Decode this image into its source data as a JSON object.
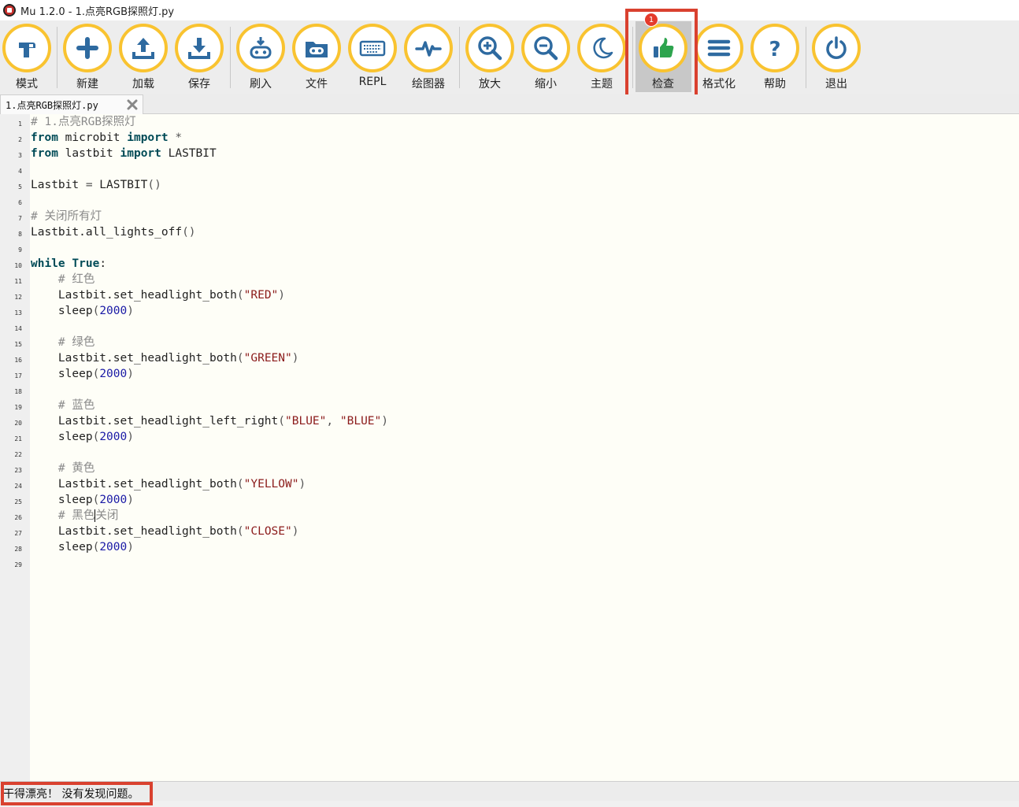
{
  "window": {
    "title": "Mu 1.2.0 - 1.点亮RGB探照灯.py"
  },
  "toolbar": {
    "buttons": [
      {
        "label": "模式",
        "icon": "mode-icon"
      },
      {
        "label": "新建",
        "icon": "plus-icon"
      },
      {
        "label": "加载",
        "icon": "upload-icon"
      },
      {
        "label": "保存",
        "icon": "download-icon"
      },
      {
        "label": "刷入",
        "icon": "flash-icon"
      },
      {
        "label": "文件",
        "icon": "files-icon"
      },
      {
        "label": "REPL",
        "icon": "keyboard-icon"
      },
      {
        "label": "绘图器",
        "icon": "pulse-icon"
      },
      {
        "label": "放大",
        "icon": "zoom-in-icon"
      },
      {
        "label": "缩小",
        "icon": "zoom-out-icon"
      },
      {
        "label": "主题",
        "icon": "moon-icon"
      },
      {
        "label": "检查",
        "icon": "thumbs-up-icon"
      },
      {
        "label": "格式化",
        "icon": "format-icon"
      },
      {
        "label": "帮助",
        "icon": "help-icon"
      },
      {
        "label": "退出",
        "icon": "power-icon"
      }
    ],
    "badge": "1",
    "colors": {
      "ring": "#f9c330",
      "icon": "#2e6aa0",
      "check": "#2da44e",
      "highlight": "#d9412f"
    }
  },
  "tab": {
    "label": "1.点亮RGB探照灯.py"
  },
  "editor": {
    "lines": [
      "# 1.点亮RGB探照灯",
      "from microbit import *",
      "from lastbit import LASTBIT",
      "",
      "Lastbit = LASTBIT()",
      "",
      "# 关闭所有灯",
      "Lastbit.all_lights_off()",
      "",
      "while True:",
      "    # 红色",
      "    Lastbit.set_headlight_both(\"RED\")",
      "    sleep(2000)",
      "",
      "    # 绿色",
      "    Lastbit.set_headlight_both(\"GREEN\")",
      "    sleep(2000)",
      "",
      "    # 蓝色",
      "    Lastbit.set_headlight_left_right(\"BLUE\", \"BLUE\")",
      "    sleep(2000)",
      "",
      "    # 黄色",
      "    Lastbit.set_headlight_both(\"YELLOW\")",
      "    sleep(2000)",
      "    # 黑色关闭",
      "    Lastbit.set_headlight_both(\"CLOSE\")",
      "    sleep(2000)",
      ""
    ]
  },
  "status": {
    "message": "干得漂亮！ 没有发现问题。"
  }
}
